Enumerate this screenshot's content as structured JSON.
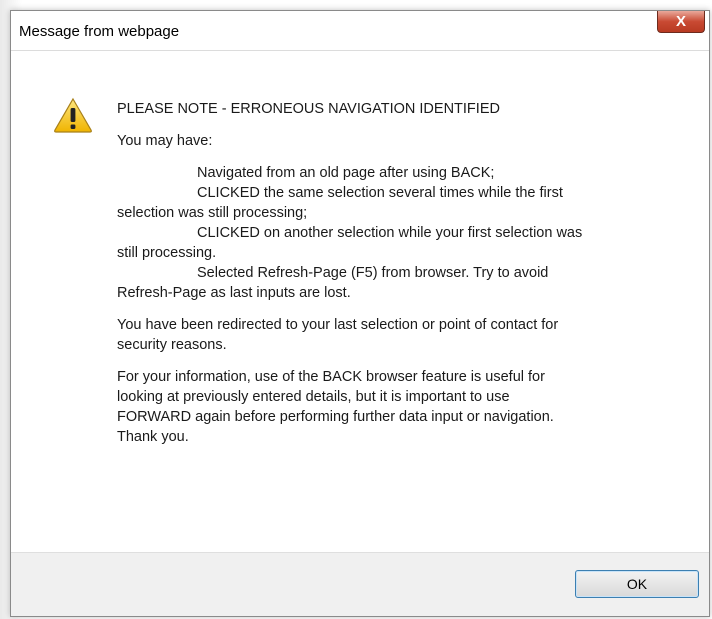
{
  "window": {
    "title": "Message from webpage",
    "close_glyph": "X"
  },
  "message": {
    "heading": "PLEASE NOTE - ERRONEOUS NAVIGATION IDENTIFIED",
    "intro": "You may have:",
    "item1_line1": "Navigated from an old page after using BACK;",
    "item2_line1": "CLICKED the same selection several times while the first",
    "item2_line2": "selection was still processing;",
    "item3_line1": "CLICKED on another selection while your first selection was",
    "item3_line2": "still processing.",
    "item4_line1": "Selected Refresh-Page (F5) from browser. Try to avoid",
    "item4_line2": "Refresh-Page as last inputs are lost.",
    "para2_line1": "You have been redirected to your last selection or point of contact for",
    "para2_line2": "security reasons.",
    "para3_line1": "For your information, use of the BACK browser feature is useful for",
    "para3_line2": "looking at previously entered details, but it is important to use",
    "para3_line3": "FORWARD again before performing further data input or navigation.",
    "para3_line4": "Thank you."
  },
  "buttons": {
    "ok_label": "OK"
  },
  "icons": {
    "warning": "warning-icon",
    "close": "close-icon"
  },
  "colors": {
    "close_button": "#c94a33",
    "warning_fill": "#f5c400",
    "ok_border": "#3c7fb1"
  }
}
